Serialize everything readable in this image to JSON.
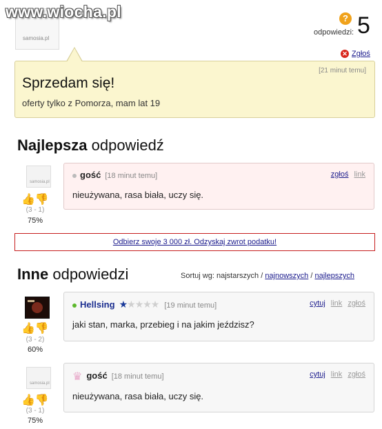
{
  "site": {
    "watermark": "www.wiocha.pl"
  },
  "header": {
    "asker_avatar_label": "samosia.pl",
    "answers_label": "odpowiedzi:",
    "answers_count": "5",
    "report_label": "Zgłoś"
  },
  "question": {
    "time": "[21 minut temu]",
    "title": "Sprzedam się!",
    "body": "oferty tylko z Pomorza, mam lat 19"
  },
  "best_section": {
    "bold": "Najlepsza",
    "rest": " odpowiedź"
  },
  "best_answer": {
    "avatar_label": "samosia.pl",
    "author": "gość",
    "time": "[18 minut temu]",
    "body": "nieużywana, rasa biała, uczy się.",
    "report": "zgłoś",
    "link": "link",
    "votes": "(3 - 1)",
    "percent": "75%"
  },
  "ad": {
    "text": "Odbierz swoje 3 000 zł. Odzyskaj zwrot podatku!"
  },
  "other_section": {
    "bold": "Inne",
    "rest": " odpowiedzi"
  },
  "sort": {
    "label": "Sortuj wg:",
    "oldest": "najstarszych",
    "sep": "/",
    "newest": "najnowszych",
    "best": "najlepszych"
  },
  "answers": [
    {
      "author": "Hellsing",
      "stars": {
        "filled": "★",
        "empty": "★★★★"
      },
      "time": "[19 minut temu]",
      "body": "jaki stan, marka, przebieg i na jakim jeździsz?",
      "quote": "cytuj",
      "link": "link",
      "report": "zgłoś",
      "votes": "(3 - 2)",
      "percent": "60%"
    },
    {
      "avatar_label": "samosia.pl",
      "author": "gość",
      "time": "[18 minut temu]",
      "body": "nieużywana, rasa biała, uczy się.",
      "quote": "cytuj",
      "link": "link",
      "report": "zgłoś",
      "votes": "(3 - 1)",
      "percent": "75%"
    }
  ],
  "icons": {
    "question": "question-icon",
    "report": "close-icon",
    "thumb_up": "thumb-up-icon",
    "thumb_down": "thumb-down-icon",
    "crown": "crown-icon"
  },
  "colors": {
    "accent_orange": "#f0a21b",
    "report_red": "#d9261c",
    "question_bg": "#fbf6cf",
    "best_bg": "#fff1f1",
    "ad_border": "#c61d1d"
  }
}
